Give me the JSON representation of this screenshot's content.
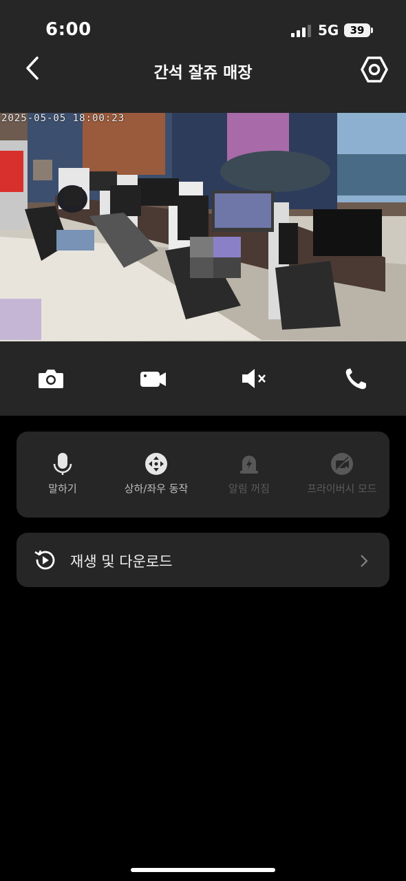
{
  "status_bar": {
    "time": "6:00",
    "network": "5G",
    "battery": "39"
  },
  "header": {
    "title": "간석 잘쥬 매장",
    "back_icon": "chevron-left-icon",
    "settings_icon": "hexagon-settings-icon"
  },
  "video": {
    "timestamp": "2025-05-05 18:00:23"
  },
  "controls": [
    {
      "name": "snapshot",
      "icon": "camera-icon"
    },
    {
      "name": "record",
      "icon": "video-camera-icon"
    },
    {
      "name": "mute",
      "icon": "speaker-muted-icon"
    },
    {
      "name": "call",
      "icon": "phone-icon"
    }
  ],
  "actions": [
    {
      "label": "말하기",
      "icon": "microphone-icon",
      "enabled": true
    },
    {
      "label": "상하/좌우 동작",
      "icon": "direction-pad-icon",
      "enabled": true
    },
    {
      "label": "알림 꺼짐",
      "icon": "alarm-off-icon",
      "enabled": false
    },
    {
      "label": "프라이버시 모드",
      "icon": "privacy-camera-off-icon",
      "enabled": false
    }
  ],
  "playback": {
    "label": "재생 및 다운로드",
    "icon": "history-play-icon",
    "chevron_icon": "chevron-right-icon"
  },
  "colors": {
    "background": "#000000",
    "panel": "#262626",
    "text": "#ffffff",
    "muted_label": "#bfbfbf",
    "disabled_label": "#5b5b5b"
  }
}
